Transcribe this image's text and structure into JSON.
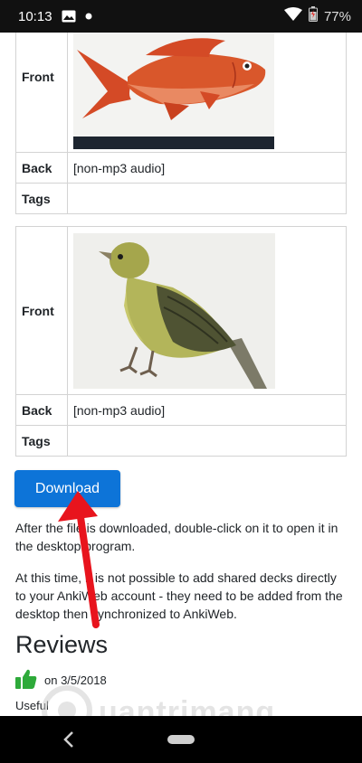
{
  "status_bar": {
    "time": "10:13",
    "battery_percent": "77%"
  },
  "cards": [
    {
      "front_label": "Front",
      "front_image": "red-fish-illustration",
      "back_label": "Back",
      "back_value": "[non-mp3 audio]",
      "tags_label": "Tags",
      "tags_value": ""
    },
    {
      "front_label": "Front",
      "front_image": "yellow-bird-illustration",
      "back_label": "Back",
      "back_value": "[non-mp3 audio]",
      "tags_label": "Tags",
      "tags_value": ""
    }
  ],
  "download_button": "Download",
  "paragraphs": [
    "After the file is downloaded, double-click on it to open it in the desktop program.",
    "At this time, it is not possible to add shared decks directly to your AnkiWeb account - they need to be added from the desktop then synchronized to AnkiWeb."
  ],
  "reviews": {
    "title": "Reviews",
    "date": "on 3/5/2018",
    "text": "Useful"
  },
  "watermark": "uantrimang",
  "colors": {
    "accent": "#0d74d8",
    "thumbs": "#2eaa3a",
    "arrow": "#e8141d"
  }
}
